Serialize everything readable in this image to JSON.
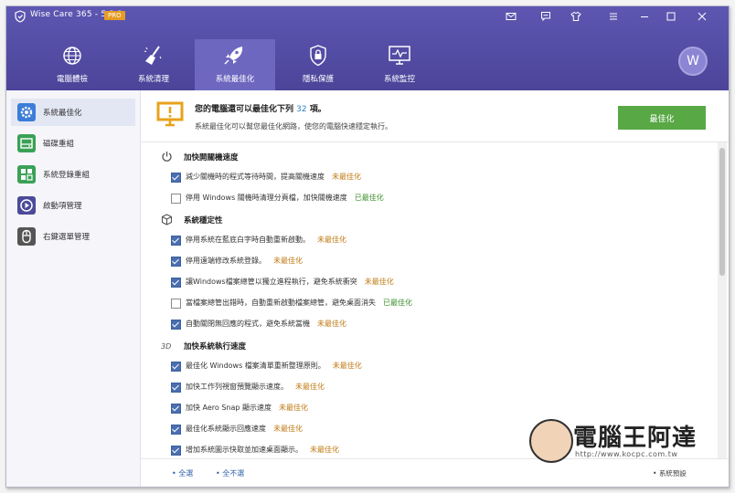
{
  "app": {
    "title": "Wise Care 365 - 5.3.2",
    "badge": "PRO"
  },
  "nav": [
    {
      "label": "電腦體檢",
      "icon": "scan-globe-icon"
    },
    {
      "label": "系統清理",
      "icon": "broom-icon"
    },
    {
      "label": "系統最佳化",
      "icon": "rocket-icon"
    },
    {
      "label": "隱私保護",
      "icon": "lock-shield-icon"
    },
    {
      "label": "系統監控",
      "icon": "monitor-pulse-icon"
    }
  ],
  "active_nav": "系統最佳化",
  "avatar_letter": "W",
  "sidebar": [
    {
      "label": "系統最佳化",
      "icon": "gear-icon",
      "color": "#3b7dd8"
    },
    {
      "label": "磁碟重組",
      "icon": "disk-icon",
      "color": "#3aa157"
    },
    {
      "label": "系統登錄重組",
      "icon": "registry-icon",
      "color": "#3aa157"
    },
    {
      "label": "啟動項管理",
      "icon": "startup-play-icon",
      "color": "#4b4b99"
    },
    {
      "label": "右鍵選單管理",
      "icon": "mouse-icon",
      "color": "#555555"
    }
  ],
  "banner": {
    "title_prefix": "您的電腦還可以最佳化下列",
    "count": "32",
    "title_suffix": "項。",
    "subtitle": "系統最佳化可以幫您最佳化網路，使您的電腦快速穩定執行。",
    "button": "最佳化"
  },
  "sections": [
    {
      "title": "加快開關機速度",
      "icon": "power-icon",
      "items": [
        {
          "text": "減少關機時的程式等待時間，提高關機速度",
          "checked": true,
          "status": "未最佳化"
        },
        {
          "text": "停用 Windows 關機時清理分頁檔，加快關機速度",
          "checked": false,
          "status": "已最佳化"
        }
      ]
    },
    {
      "title": "系統穩定性",
      "icon": "cube-icon",
      "items": [
        {
          "text": "停用系統在藍底白字時自動重新啟動。",
          "checked": true,
          "status": "未最佳化"
        },
        {
          "text": "停用遠端修改系統登錄。",
          "checked": true,
          "status": "未最佳化"
        },
        {
          "text": "讓Windows檔案總管以獨立進程執行，避免系統衝突",
          "checked": true,
          "status": "未最佳化"
        },
        {
          "text": "當檔案總管出錯時，自動重新啟動檔案總管，避免桌面消失",
          "checked": false,
          "status": "已最佳化"
        },
        {
          "text": "自動關閉無回應的程式，避免系統當機",
          "checked": true,
          "status": "未最佳化"
        }
      ]
    },
    {
      "title": "加快系統執行速度",
      "icon": "3d-icon",
      "items": [
        {
          "text": "最佳化 Windows 檔案清單重新整理原則。",
          "checked": true,
          "status": "未最佳化"
        },
        {
          "text": "加快工作列視窗預覽顯示速度。",
          "checked": true,
          "status": "未最佳化"
        },
        {
          "text": "加快 Aero Snap 顯示速度",
          "checked": true,
          "status": "未最佳化"
        },
        {
          "text": "最佳化系統顯示回應速度",
          "checked": true,
          "status": "未最佳化"
        },
        {
          "text": "增加系統圖示快取並加速桌面顯示。",
          "checked": true,
          "status": "未最佳化"
        }
      ]
    }
  ],
  "footer": {
    "select_all": "全選",
    "select_none": "全不選",
    "default": "系統預設"
  },
  "watermark": {
    "text": "電腦王阿達",
    "url": "http://www.kocpc.com.tw"
  },
  "colors": {
    "header": "#5a54ad",
    "active_tab": "#6d67c0",
    "accent_green": "#58a845",
    "pending": "#c07a12",
    "done": "#3b8f2b"
  }
}
